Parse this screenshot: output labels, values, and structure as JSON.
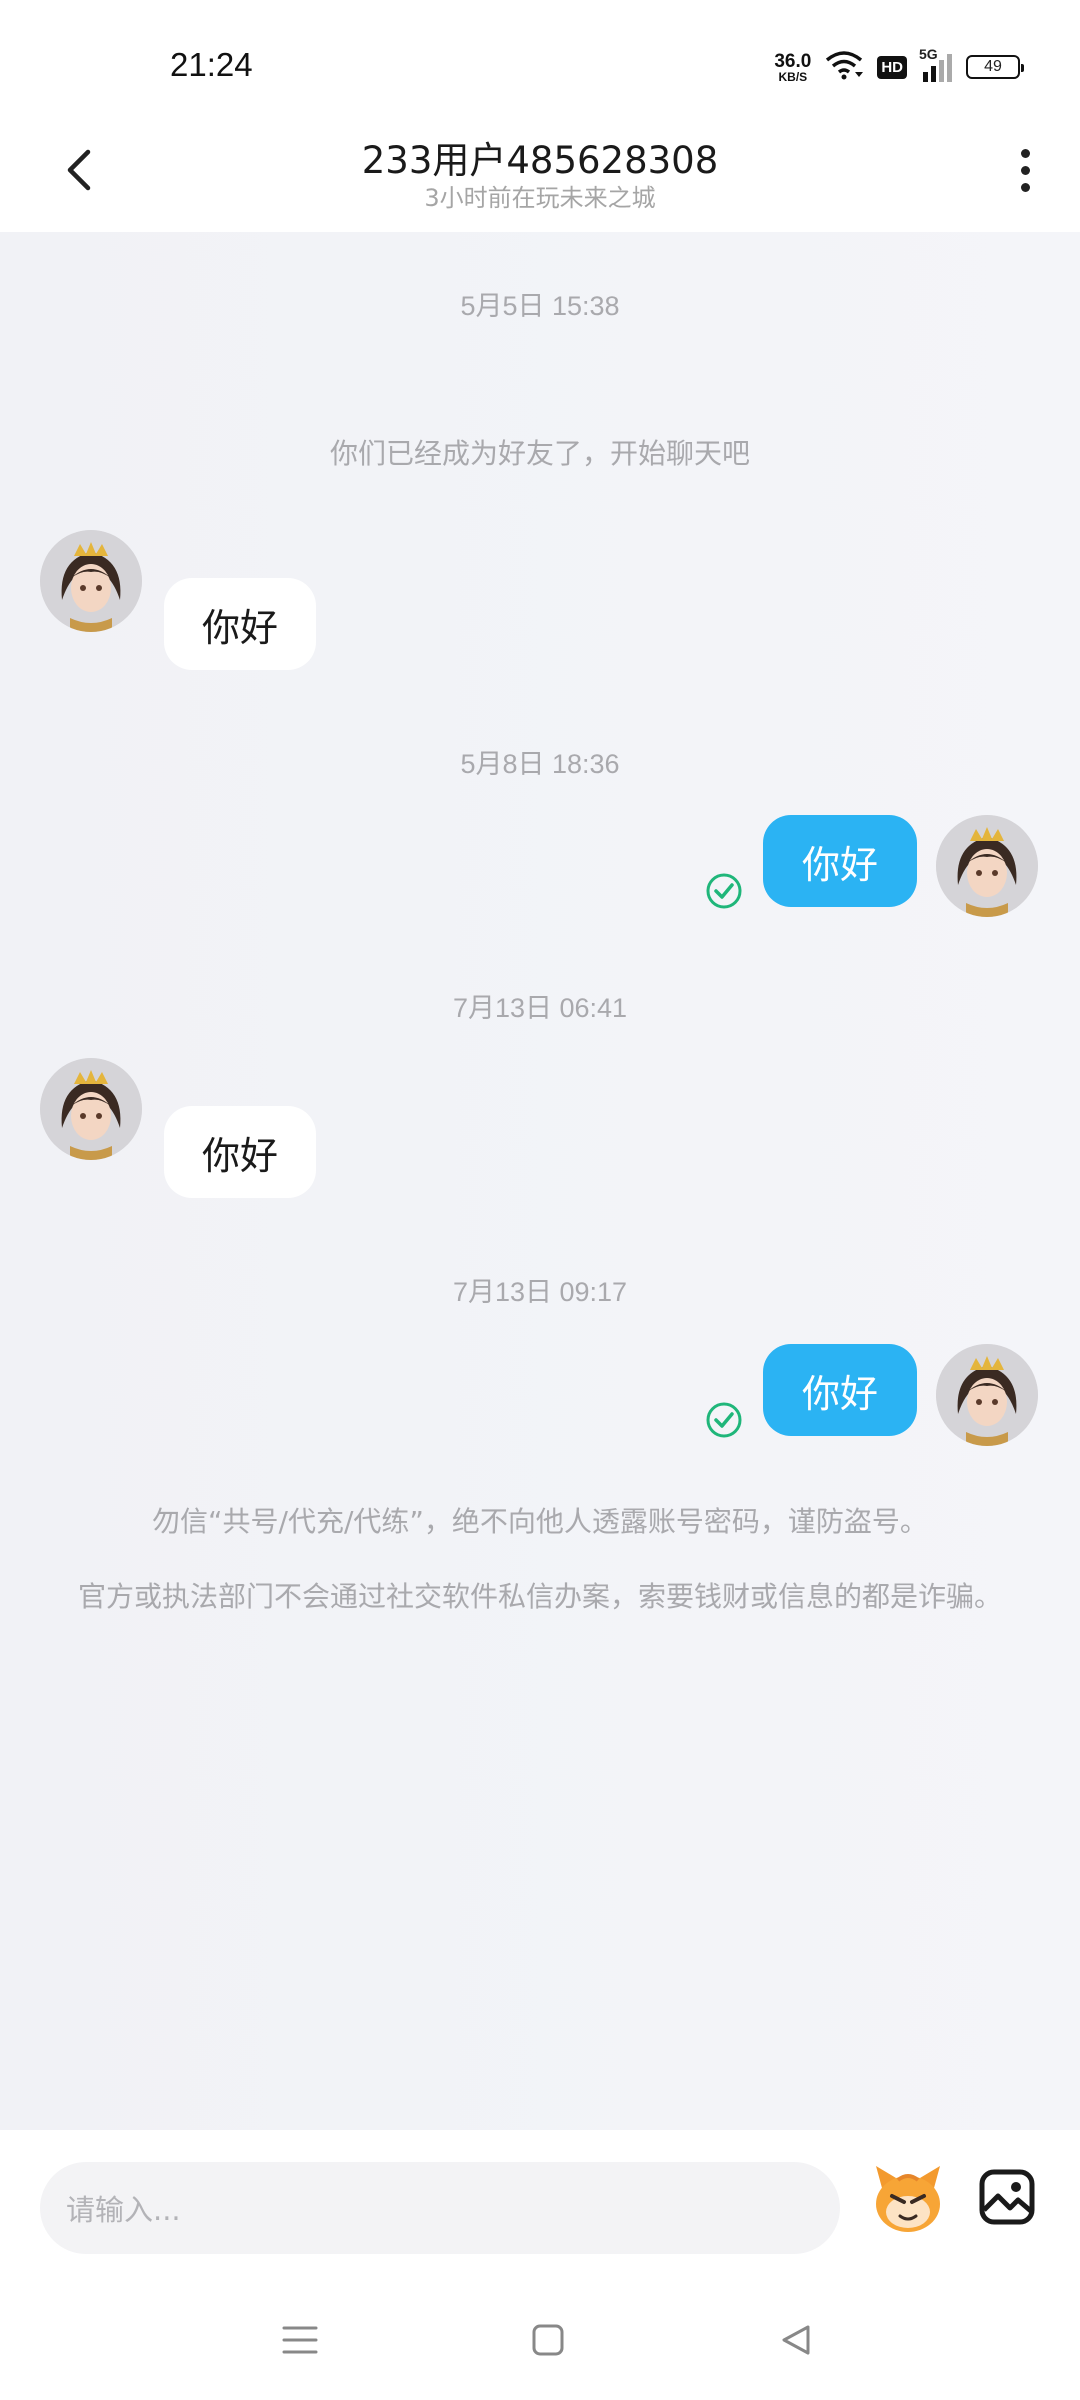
{
  "status_bar": {
    "time": "21:24",
    "net_speed_value": "36.0",
    "net_speed_unit": "KB/S",
    "hd_label": "HD",
    "network_label": "5G",
    "battery_level": "49"
  },
  "header": {
    "title": "233用户485628308",
    "subtitle": "3小时前在玩未来之城"
  },
  "chat": {
    "messages": [
      {
        "type": "timestamp",
        "text": "5月5日 15:38"
      },
      {
        "type": "system",
        "text": "你们已经成为好友了，开始聊天吧"
      },
      {
        "type": "incoming",
        "text": "你好"
      },
      {
        "type": "timestamp",
        "text": "5月8日 18:36"
      },
      {
        "type": "outgoing",
        "text": "你好",
        "status": "read"
      },
      {
        "type": "timestamp",
        "text": "7月13日 06:41"
      },
      {
        "type": "incoming",
        "text": "你好"
      },
      {
        "type": "timestamp",
        "text": "7月13日 09:17"
      },
      {
        "type": "outgoing",
        "text": "你好",
        "status": "read"
      }
    ],
    "warning_1": "勿信“共号/代充/代练”，绝不向他人透露账号密码，谨防盗号。",
    "warning_2": "官方或执法部门不会通过社交软件私信办案，索要钱财或信息的都是诈骗。"
  },
  "input_bar": {
    "placeholder": "请输入..."
  },
  "colors": {
    "outgoing_bubble": "#2bb3f3",
    "incoming_bubble": "#ffffff",
    "read_check": "#1fb67a",
    "chat_background": "#f1f2f6"
  },
  "icons": [
    "back-arrow-icon",
    "more-vertical-icon",
    "read-check-icon",
    "emoji-mascot-icon",
    "image-icon",
    "menu-icon",
    "home-square-icon",
    "back-triangle-icon"
  ]
}
